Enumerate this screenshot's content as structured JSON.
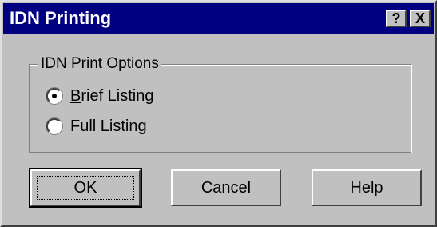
{
  "window": {
    "title": "IDN Printing",
    "help_button": "?",
    "close_button": "X"
  },
  "group": {
    "label": "IDN Print Options",
    "options": [
      {
        "label": "Brief Listing",
        "selected": true
      },
      {
        "label": "Full Listing",
        "selected": false
      }
    ]
  },
  "buttons": {
    "ok": "OK",
    "cancel": "Cancel",
    "help": "Help"
  }
}
